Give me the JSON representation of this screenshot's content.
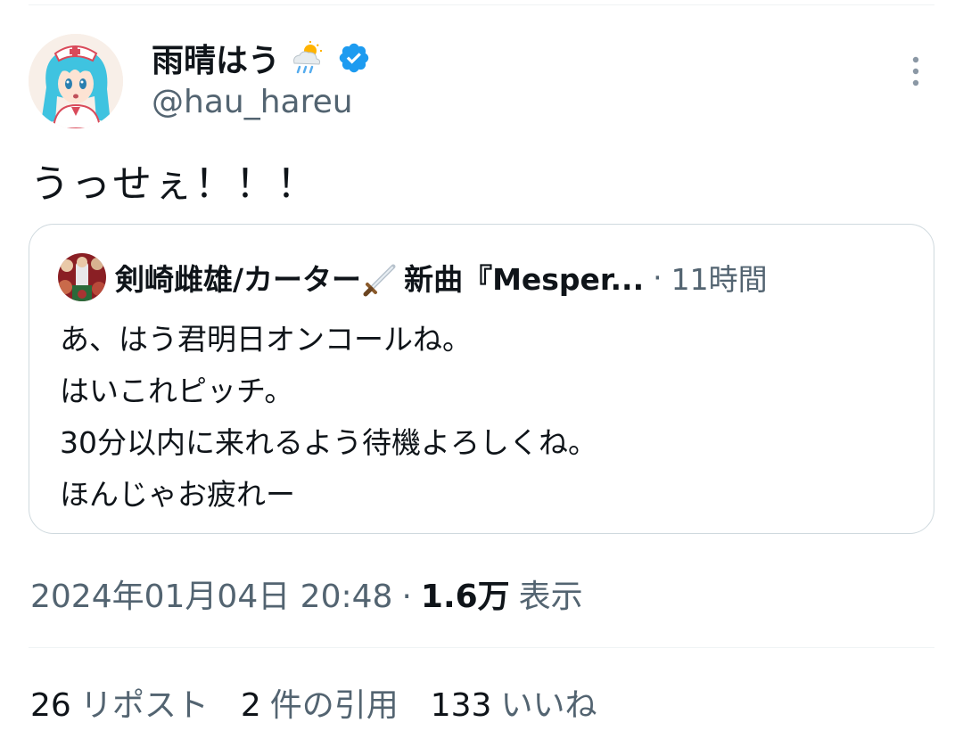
{
  "tweet": {
    "display_name": "雨晴はう",
    "name_emoji": "weather-icon",
    "verified_icon": "verified-badge-icon",
    "handle": "@hau_hareu",
    "text": "うっせぇ！！！",
    "timestamp": "2024年01月04日 20:48",
    "separator": "·",
    "views_count": "1.6万",
    "views_label": "表示",
    "accent_color": "#1d9bf0"
  },
  "quote": {
    "name_part1": "剣崎雌雄/カーター",
    "name_emoji": "sword-icon",
    "name_part2": "新曲『Mesper...",
    "separator": "·",
    "time": "11時間",
    "lines": [
      "あ、はう君明日オンコールね。",
      "はいこれピッチ。",
      "30分以内に来れるよう待機よろしくね。",
      "ほんじゃお疲れー"
    ]
  },
  "stats": [
    {
      "count": "26",
      "label": "リポスト"
    },
    {
      "count": "2",
      "label": "件の引用"
    },
    {
      "count": "133",
      "label": "いいね"
    }
  ]
}
